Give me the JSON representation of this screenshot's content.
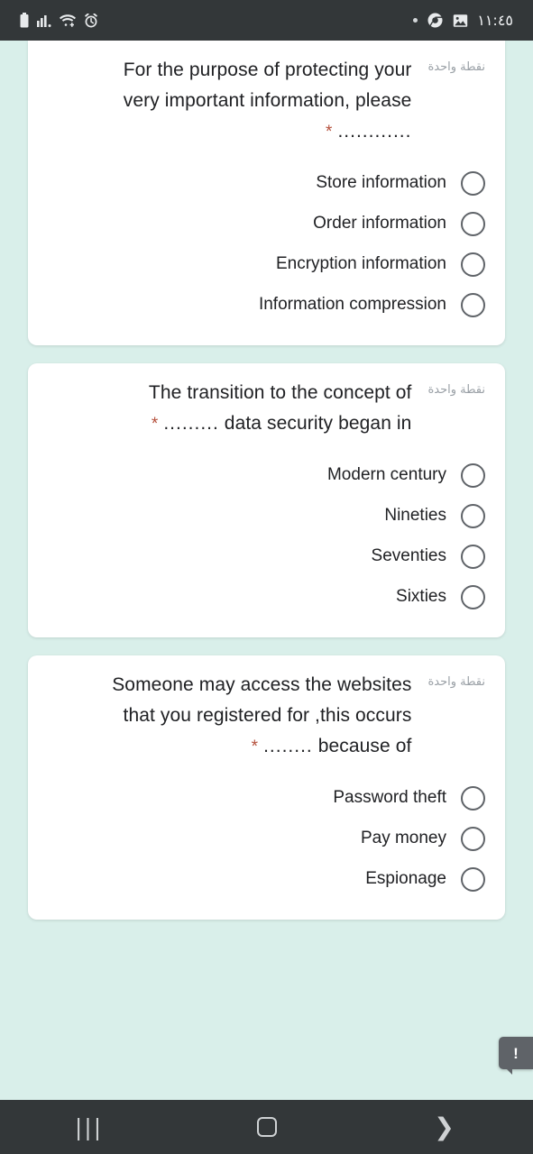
{
  "status_bar": {
    "time": "١١:٤٥",
    "left_icons": [
      "battery-icon",
      "signal-bars-icon",
      "wifi-icon",
      "alarm-icon"
    ],
    "right_icons": [
      "notification-dot-icon",
      "chrome-icon",
      "image-icon"
    ]
  },
  "form": {
    "points_label": "نقطة واحدة",
    "required_marker": "*",
    "questions": [
      {
        "text_line_1": "For the purpose of protecting your",
        "text_line_2": "very important information, please",
        "blank": "............",
        "options": [
          "Store information",
          "Order information",
          "Encryption information",
          "Information compression"
        ]
      },
      {
        "text_line_1": "The transition to the concept of",
        "text_line_2": "data security began in",
        "blank": ".........",
        "options": [
          "Modern century",
          "Nineties",
          "Seventies",
          "Sixties"
        ]
      },
      {
        "text_line_1": "Someone may access the websites",
        "text_line_2": "that you registered for ,this occurs",
        "text_line_3": "because of",
        "blank": "........",
        "options": [
          "Password theft",
          "Pay money",
          "Espionage"
        ]
      }
    ]
  },
  "feedback_badge": {
    "glyph": "!"
  },
  "nav_bar": {
    "recents": "|||",
    "home": "",
    "back": "❯"
  },
  "colors": {
    "page_background": "#d9efea",
    "card_background": "#ffffff",
    "required_star": "#b5503c",
    "text_primary": "#202124",
    "text_muted": "#9aa0a6",
    "system_bar": "#333739"
  }
}
